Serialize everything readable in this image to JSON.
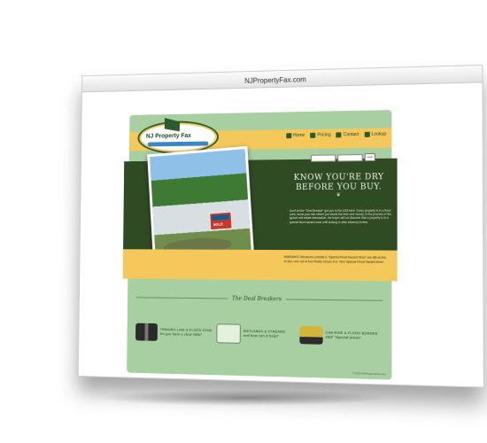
{
  "browser": {
    "window_title": "NJPropertyFax.com"
  },
  "site": {
    "logo_text": "NJ Property Fax",
    "nav": [
      {
        "label": "Home",
        "icon": "home-icon"
      },
      {
        "label": "Pricing",
        "icon": "tag-icon"
      },
      {
        "label": "Contact",
        "icon": "mail-icon"
      },
      {
        "label": "Lookup",
        "icon": "search-icon"
      }
    ],
    "search": {
      "button_label": "login"
    },
    "headline_line1": "KNOW YOU'RE DRY",
    "headline_line2": "BEFORE YOU BUY.",
    "hero_paragraph": "Don't let the \"Deal Breaker\" get you to the USA here. Every property is in a flood zone, know your risk before you invest the time and money. In the process of the typical real estate transaction, the buyer will not discover that a property is in a special flood hazard zone until closing or after attorney review.",
    "warning_text": "WARNING! Structures outside a \"Special Flood Hazard Area\" are still at risk. In fact, one out of four floods occurs in a \"Non Special Flood Hazard Area\".",
    "photo_sign_text": "SOLD",
    "deal_breakers_title": "The Deal Breakers",
    "cards": [
      {
        "title": "TRIBORO LINE & FLOOD ZONE",
        "subtitle": "Do you have a clear title?",
        "icon": "binoculars-icon"
      },
      {
        "title": "WETLANDS & STREAMS",
        "subtitle": "and how can it help?",
        "icon": "map-icon"
      },
      {
        "title": "CAN RISE & FLOOD BORDER",
        "subtitle": "DEP \"Special Areas\"",
        "icon": "wheelbarrow-icon"
      }
    ],
    "footer_text": "© 2015 NJPropertyFax.com"
  }
}
